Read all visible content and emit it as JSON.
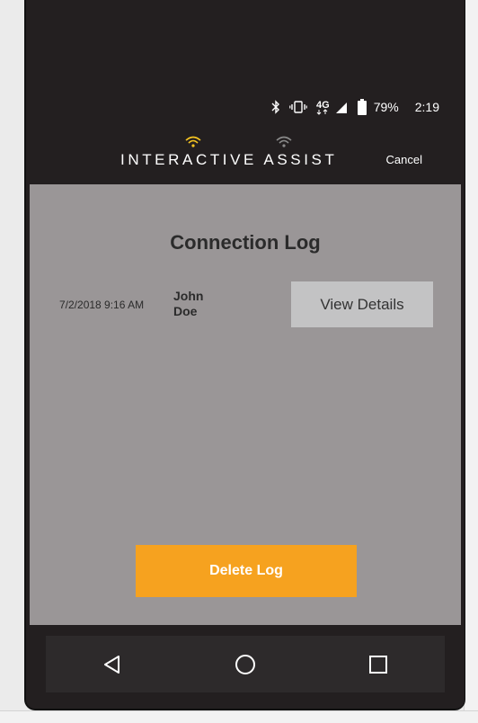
{
  "status_bar": {
    "battery_percent": "79%",
    "time": "2:19",
    "network": "4G",
    "icons": [
      "bluetooth-icon",
      "vibrate-icon",
      "4g-lte-icon",
      "signal-icon",
      "battery-icon"
    ]
  },
  "header": {
    "logo_text": "INTERACTIVE ASSIST",
    "cancel_label": "Cancel"
  },
  "main": {
    "title": "Connection Log",
    "log_entries": [
      {
        "date": "7/2/2018 9:16 AM",
        "name": "John Doe",
        "action_label": "View Details"
      }
    ],
    "delete_label": "Delete Log"
  },
  "nav": {
    "icons": [
      "back-icon",
      "home-icon",
      "recents-icon"
    ]
  },
  "colors": {
    "accent": "#f6a21f",
    "header_bg": "#231f20",
    "content_bg": "#9a9697",
    "button_gray": "#c3c3c4"
  }
}
